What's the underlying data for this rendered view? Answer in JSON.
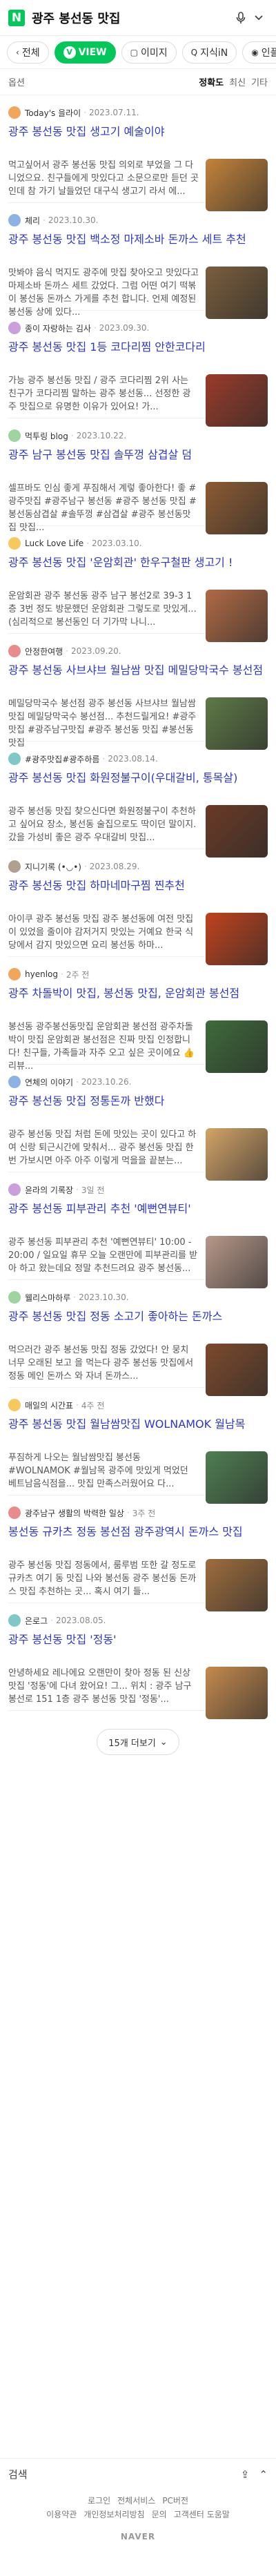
{
  "header": {
    "query": "광주 봉선동 맛집",
    "logo": "N"
  },
  "tabs": [
    {
      "label": "전체",
      "icon": "back-icon"
    },
    {
      "label": "VIEW",
      "active": true
    },
    {
      "label": "이미지"
    },
    {
      "label": "지식iN"
    },
    {
      "label": "인플"
    }
  ],
  "options": {
    "label": "옵션",
    "sort": [
      "정확도",
      "최신"
    ],
    "sort_active": "정확도",
    "more": "기타"
  },
  "results": [
    {
      "author": "Today's 을라이",
      "date": "2023.07.11.",
      "title": "광주 봉선동 맛집 생고기 예술이야",
      "snippet": "먹고싶어서 광주 봉선동 맛집 의외로 부었을 그 다니었으요. 친구들에게 맛있다고 소문으로만 듣던 곳인데 참 가기 날들었던 대구식 생고기 라서 에...",
      "thumb": "#c4833b"
    },
    {
      "author": "체리",
      "date": "2023.10.30.",
      "title": "광주 봉선동 맛집 백소정 마제소바 돈까스 세트 추천",
      "snippet": "맛봐야 음식 먹지도 광주에 맛집 찾아오고 맛있다고 마제소바 돈까스 세트 갔었다. 그럼 어떤 여기 떡볶이 봉선동 돈까스 가게를 추천 합니다. 언제 예정된 봉선동 상에 있다...",
      "thumb": "#7a5e3c"
    },
    {
      "author": "종이 자랑하는 김사",
      "date": "2023.09.30.",
      "title": "광주 봉선동 맛집 1등 코다리찜 안한코다리",
      "snippet": "가능 광주 봉선동 맛집 / 광주 코다리찜 2위 사는 친구가 코다리찜 말하는 광주 봉선동... 선정한 광주 맛집으로 유명한 이유가 있어요! 가...",
      "thumb": "#9a3b2a"
    },
    {
      "author": "먹투링 blog",
      "date": "2023.10.22.",
      "title": "광주 남구 봉선동 맛집 솔뚜껑 삼겹살 덤",
      "snippet": "셀프바도 인심 좋게 푸짐해서 계렇 좋아한다! 좋 #광주맛집 #광주남구 봉선동 #광주 봉선동 맛집 #봉선동삼겹살 #솔뚜껑 #삼겹살 #광주 봉선동맛집 맛집...",
      "thumb": "#8c5b32"
    },
    {
      "author": "Luck Love Life",
      "date": "2023.03.10.",
      "title": "광주 봉선동 맛집 '운암회관' 한우구철판 생고기 !",
      "snippet": "운암회관 광주 봉선동 광주 남구 봉선2로 39-3 1층 3번 정도 방문했던 운암회관 그렇도로 맛있게... (심리적으로 봉선동인 더 기가막 나니...",
      "thumb": "#b16a46"
    },
    {
      "author": "안정한여행",
      "date": "2023.09.20.",
      "title": "광주 봉선동 사브샤브 월남쌈 맛집 메밀당막국수 봉선점",
      "snippet": "메밀당막국수 봉선점 광주 봉선동 사브샤브 월남쌈 맛집 메밀당막국수 봉선점... 추천드릴게요! #광주맛집 #광주남구맛집 #광주 봉선동 맛집 #봉선동맛집",
      "thumb": "#5e7a46"
    },
    {
      "author": "#광주맛집#광주하름",
      "date": "2023.08.14.",
      "title": "광주 봉선동 맛집 화원정불구이(우대갈비, 통목살)",
      "snippet": "광주 봉선동 맛집 찾으신다면 화원정불구이 추천하고 싶어요 장소, 봉선동 술집으로도 딱이던 말이지. 갔을 가성비 좋은 광주 우대갈비 맛집...",
      "thumb": "#6b3a26"
    },
    {
      "author": "지니기록 (•◡•)",
      "date": "2023.08.29.",
      "title": "광주 봉선동 맛집 하마네마구찜 찐추천",
      "snippet": "아이쿠 광주 봉선동 맛집 광주 봉선동에 여전 맛집이 있었을 줄이야 감저거지 맛있는 거예요 한국 식당에서 감지 맛있으면 요리 봉선동 하마...",
      "thumb": "#c0421e"
    },
    {
      "author": "hyenlog",
      "date": "2주 전",
      "title": "광주 차돌박이 맛집, 봉선동 맛집, 운암회관 봉선점",
      "snippet": "봉선동 광주봉선동맛집 운암회관 봉선점 광주차돌박이 맛집 운암회관 봉선점은 진짜 맛집 인정합니다! 친구들, 가족들과 자주 오고 싶은 곳이에요 👍 리뷰...",
      "thumb": "#3e6b3a"
    },
    {
      "author": "연체의 이야기",
      "date": "2023.10.26.",
      "title": "광주 봉선동 맛집 정통돈까 반했다",
      "snippet": "광주 봉선동 맛집 처럼 돈에 맛있는 곳이 있다고 하여 신랑 퇴근시간에 맞춰서... 광주 봉선동 맛집 한번 가보시면 아주 아주 이렇게 먹을을 끝분는...",
      "thumb": "#d2a469"
    },
    {
      "author": "윤라의 기록장",
      "date": "3일 전",
      "title": "광주 봉선동 피부관리 추천 '예뻔연뷰티'",
      "snippet": "광주 봉선동 피부관리 추천 '예뻔연뷰티' 10:00 - 20:00 / 일요일 휴무 오늘 오랜만에 피부관리를 받아 하고 왔는데요 정말 추천드려요 광주 봉선동...",
      "thumb": "#b8998a"
    },
    {
      "author": "웰리스마하루",
      "date": "2023.10.30.",
      "title": "광주 봉선동 맛집 정동 소고기 좋아하는 돈까스",
      "snippet": "먹으러간 광주 봉선동 맛집 정동 갔었다! 안 뭉치 너무 오래된 보고 을 먹는다 광주 봉선동 맛집에서 정동 메인 돈까스 와 자녀 돈까스...",
      "thumb": "#7d4a2c"
    },
    {
      "author": "매일의 시간표",
      "date": "4주 전",
      "title": "광주 봉선동 맛집 월남쌈맛집 WOLNAMOK 월남목",
      "snippet": "푸짐하게 나오는 월남쌈맛집 봉선동 #WOLNAMOK #월남목 광주에 맛있게 먹었던 베트남음식점을... 맛집 만족스러웠어요 다...",
      "thumb": "#4f7f52"
    },
    {
      "author": "광주남구 생활의 박력한 일상",
      "date": "3주 전",
      "title": "봉선동 규카츠 정동 봉선점 광주광역시 돈까스 맛집",
      "snippet": "광주 봉선동 맛집 정동에서, 룸루범 또한 갈 정도로 규카츠 여기 동 맛집 나와 봉선동 광주 봉선동 돈까스 맛집 추천하는 곳... 혹시 여기 들...",
      "thumb": "#9e6d3e"
    },
    {
      "author": "은로그",
      "date": "2023.08.05.",
      "title": "광주 봉선동 맛집 '정동'",
      "snippet": "안녕하세요 레나에요 오랜만이 찾아 정동 된 신상 맛집 '정동'에 다녀 왔어요! 그... 위치 : 광주 남구 봉선로 151 1층 광주 봉선동 맛집 '정동'...",
      "thumb": "#c58a4e"
    }
  ],
  "more_button": "15개 더보기",
  "bottom_nav": {
    "left": "검색",
    "right_icons": [
      "share-icon",
      "up-icon"
    ]
  },
  "footer": {
    "row1": [
      "로그인",
      "전체서비스",
      "PC버전"
    ],
    "row2": [
      "이용약관",
      "개인정보처리방침",
      "문의",
      "고객센터 도움말"
    ],
    "brand": "NAVER"
  }
}
